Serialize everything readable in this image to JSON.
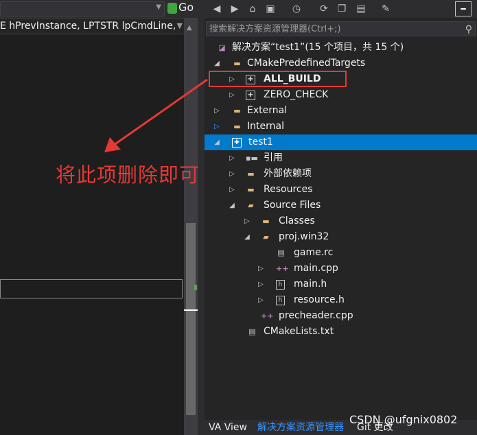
{
  "editor": {
    "go_label": "Go",
    "signature_text": "E hPrevInstance, LPTSTR lpCmdLine,"
  },
  "solution_explorer": {
    "search_placeholder": "搜索解决方案资源管理器(Ctrl+;)",
    "solution_label": "解决方案“test1”(15 个项目，共 15 个)",
    "items": [
      {
        "label": "CMakePredefinedTargets",
        "icon": "folder-icon",
        "expanded": true
      },
      {
        "label": "ALL_BUILD",
        "icon": "project-icon",
        "bold": true
      },
      {
        "label": "ZERO_CHECK",
        "icon": "project-icon"
      },
      {
        "label": "External",
        "icon": "folder-icon"
      },
      {
        "label": "Internal",
        "icon": "folder-icon"
      },
      {
        "label": "test1",
        "icon": "project-icon",
        "selected": true,
        "expanded": true
      },
      {
        "label": "引用",
        "icon": "references-icon"
      },
      {
        "label": "外部依赖项",
        "icon": "folder-icon"
      },
      {
        "label": "Resources",
        "icon": "folder-icon"
      },
      {
        "label": "Source Files",
        "icon": "folder-open-icon",
        "expanded": true
      },
      {
        "label": "Classes",
        "icon": "folder-icon"
      },
      {
        "label": "proj.win32",
        "icon": "folder-open-icon",
        "expanded": true
      },
      {
        "label": "game.rc",
        "icon": "rc-file-icon"
      },
      {
        "label": "main.cpp",
        "icon": "cpp-file-icon"
      },
      {
        "label": "main.h",
        "icon": "header-file-icon"
      },
      {
        "label": "resource.h",
        "icon": "header-file-icon"
      },
      {
        "label": "precheader.cpp",
        "icon": "cpp-file-icon"
      },
      {
        "label": "CMakeLists.txt",
        "icon": "text-file-icon"
      }
    ]
  },
  "bottom_tabs": [
    "VA View",
    "解决方案资源管理器",
    "Git 更改"
  ],
  "annotation": {
    "callout_text": "将此项删除即可",
    "color": "#e53935"
  },
  "watermark": "CSDN @ufgnix0802",
  "colors": {
    "selection": "#007acc",
    "accent_tab": "#3794ff"
  }
}
